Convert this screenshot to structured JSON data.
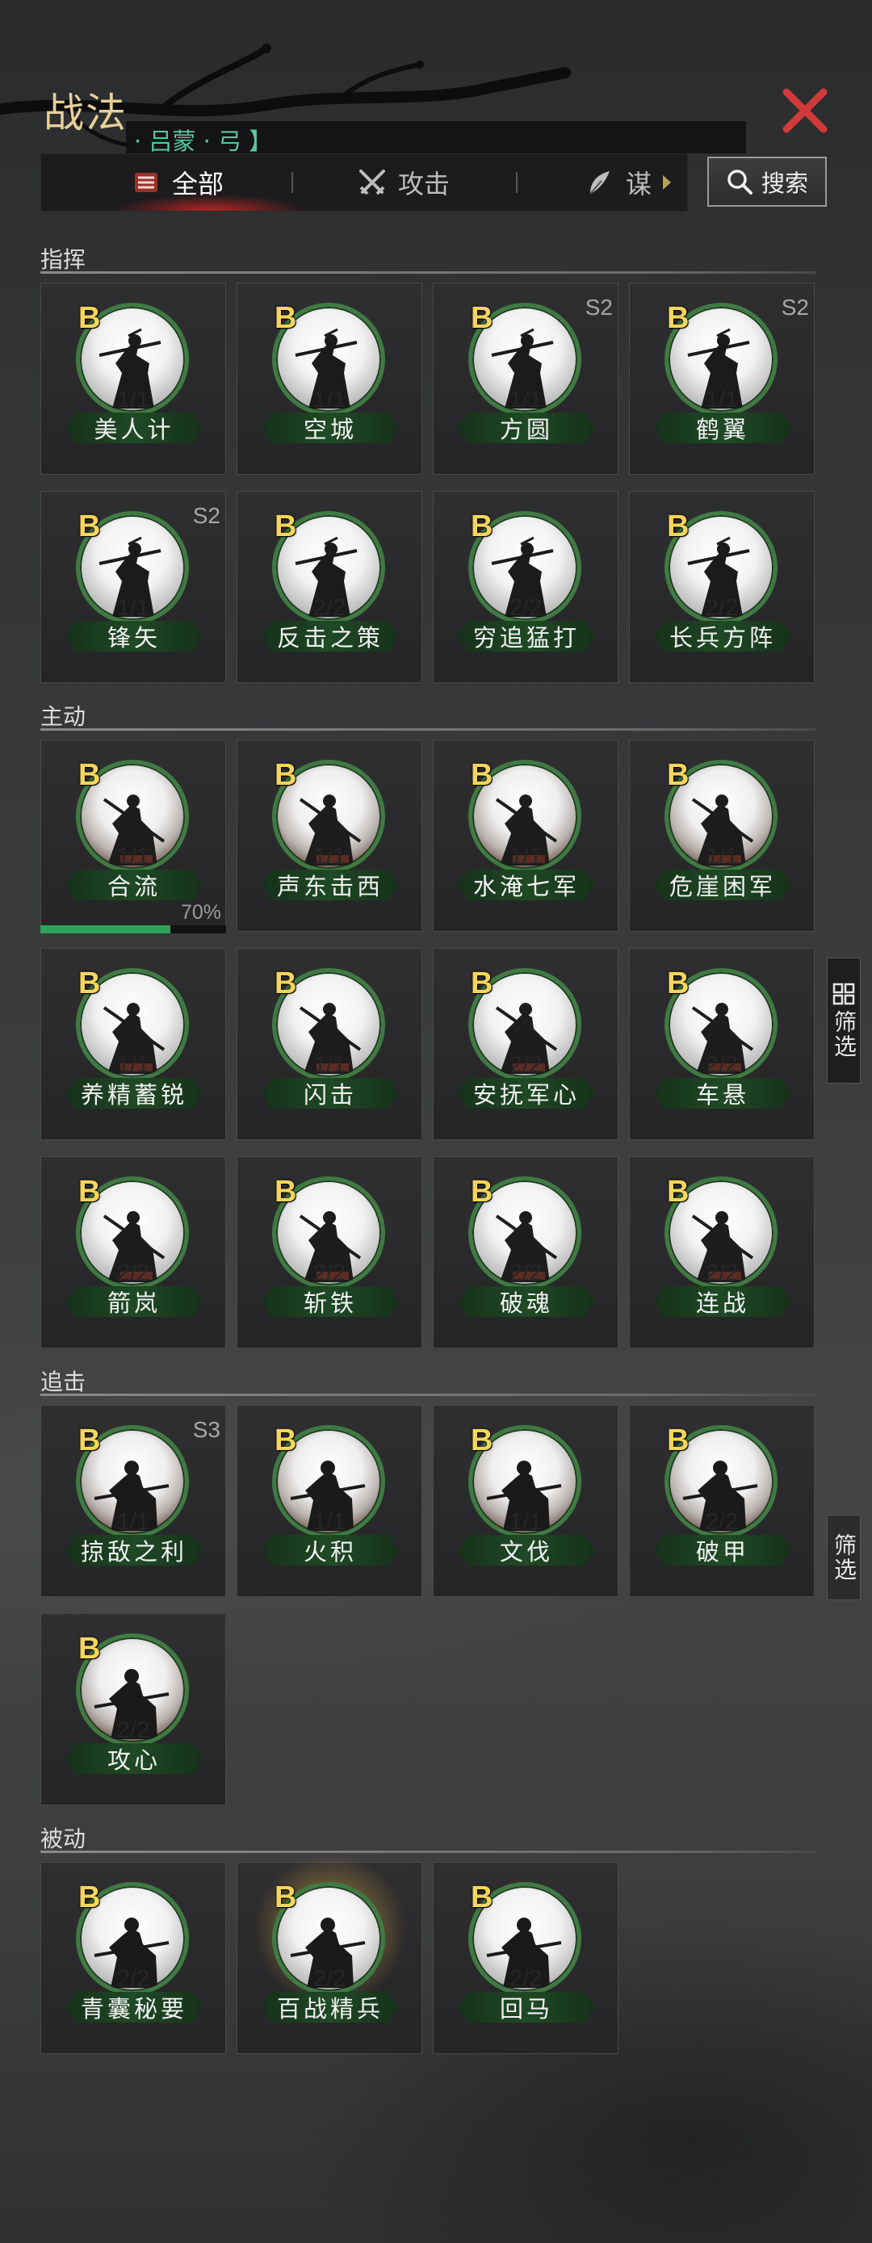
{
  "window": {
    "title": "战法",
    "hero": "· 吕蒙 · 弓 】"
  },
  "tabs": [
    {
      "label": "全部",
      "icon": "scroll-icon",
      "active": true
    },
    {
      "label": "攻击",
      "icon": "crossed-swords-icon",
      "active": false
    },
    {
      "label": "谋",
      "icon": "feather-icon",
      "active": false
    }
  ],
  "search_label": "搜索",
  "filter_label": "筛选",
  "sections": [
    {
      "title": "指挥"
    },
    {
      "title": "主动"
    },
    {
      "title": "追击"
    },
    {
      "title": "被动"
    }
  ],
  "cards": [
    {
      "name": "美人计",
      "grade": "B",
      "level": "1/1",
      "season": ""
    },
    {
      "name": "空城",
      "grade": "B",
      "level": "1/1",
      "season": ""
    },
    {
      "name": "方圆",
      "grade": "B",
      "level": "1/1",
      "season": "S2"
    },
    {
      "name": "鹤翼",
      "grade": "B",
      "level": "1/1",
      "season": "S2"
    },
    {
      "name": "锋矢",
      "grade": "B",
      "level": "1/1",
      "season": "S2"
    },
    {
      "name": "反击之策",
      "grade": "B",
      "level": "2/2",
      "season": ""
    },
    {
      "name": "穷追猛打",
      "grade": "B",
      "level": "2/2",
      "season": ""
    },
    {
      "name": "长兵方阵",
      "grade": "B",
      "level": "2/2",
      "season": ""
    },
    {
      "name": "合流",
      "grade": "B",
      "level": "1/1",
      "season": ""
    },
    {
      "name": "声东击西",
      "grade": "B",
      "level": "1/1",
      "season": ""
    },
    {
      "name": "水淹七军",
      "grade": "B",
      "level": "1/1",
      "season": ""
    },
    {
      "name": "危崖困军",
      "grade": "B",
      "level": "1/1",
      "season": ""
    },
    {
      "name": "养精蓄锐",
      "grade": "B",
      "level": "1/1",
      "season": ""
    },
    {
      "name": "闪击",
      "grade": "B",
      "level": "1/1",
      "season": ""
    },
    {
      "name": "安抚军心",
      "grade": "B",
      "level": "2/2",
      "season": ""
    },
    {
      "name": "车悬",
      "grade": "B",
      "level": "2/2",
      "season": ""
    },
    {
      "name": "箭岚",
      "grade": "B",
      "level": "2/2",
      "season": ""
    },
    {
      "name": "斩铁",
      "grade": "B",
      "level": "2/2",
      "season": ""
    },
    {
      "name": "破魂",
      "grade": "B",
      "level": "2/2",
      "season": ""
    },
    {
      "name": "连战",
      "grade": "B",
      "level": "2/2",
      "season": ""
    },
    {
      "name": "掠敌之利",
      "grade": "B",
      "level": "1/1",
      "season": "S3"
    },
    {
      "name": "火积",
      "grade": "B",
      "level": "1/1",
      "season": ""
    },
    {
      "name": "文伐",
      "grade": "B",
      "level": "1/1",
      "season": ""
    },
    {
      "name": "破甲",
      "grade": "B",
      "level": "2/2",
      "season": ""
    },
    {
      "name": "攻心",
      "grade": "B",
      "level": "2/2",
      "season": ""
    },
    {
      "name": "青囊秘要",
      "grade": "B",
      "level": "2/2",
      "season": ""
    },
    {
      "name": "百战精兵",
      "grade": "B",
      "level": "2/2",
      "season": ""
    },
    {
      "name": "回马",
      "grade": "B",
      "level": "2/2",
      "season": ""
    }
  ],
  "progress": {
    "label": "70%",
    "value": 0.7
  },
  "colors": {
    "accent_gold": "#e7cf98",
    "hero_teal": "#59c8a0",
    "ring_green": "#3f7a42",
    "close_red": "#d23a3a",
    "progress_green": "#2aa557"
  }
}
